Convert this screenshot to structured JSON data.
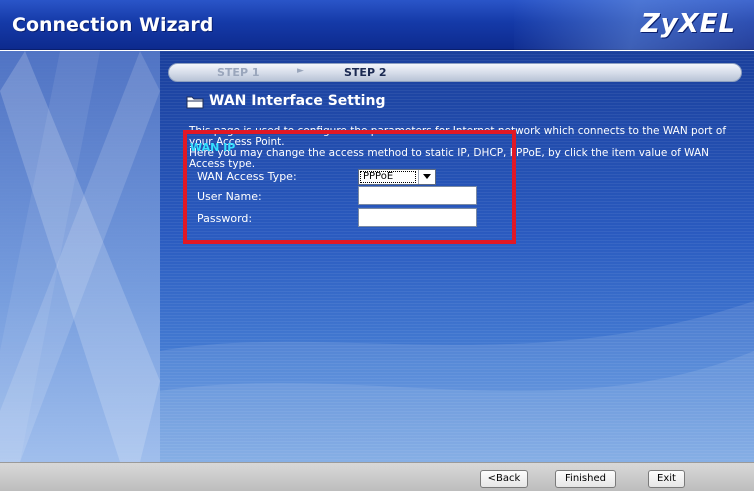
{
  "window": {
    "title": "Connection Wizard",
    "brand": "ZyXEL"
  },
  "steps": {
    "step1": "STEP 1",
    "step2": "STEP 2",
    "active": "STEP 2"
  },
  "section": {
    "title": "WAN Interface Setting",
    "icon": "folder-icon"
  },
  "description": {
    "line1": "This page is used to configure the parameters for Internet network which connects to the WAN port of your Access Point.",
    "line2": "Here you may change the access method to static IP, DHCP, PPPoE, by click the item value of WAN Access type."
  },
  "form": {
    "group_label": "WAN IP",
    "access_type_label": "WAN Access Type:",
    "access_type_value": "PPPoE",
    "username_label": "User Name:",
    "username_value": "",
    "password_label": "Password:",
    "password_value": ""
  },
  "buttons": {
    "back": "<Back",
    "finished": "Finished",
    "exit": "Exit"
  },
  "colors": {
    "header": "#153aa8",
    "highlight_border": "#e11825",
    "group_label": "#33e0ff",
    "footer": "#c8c8c8"
  }
}
